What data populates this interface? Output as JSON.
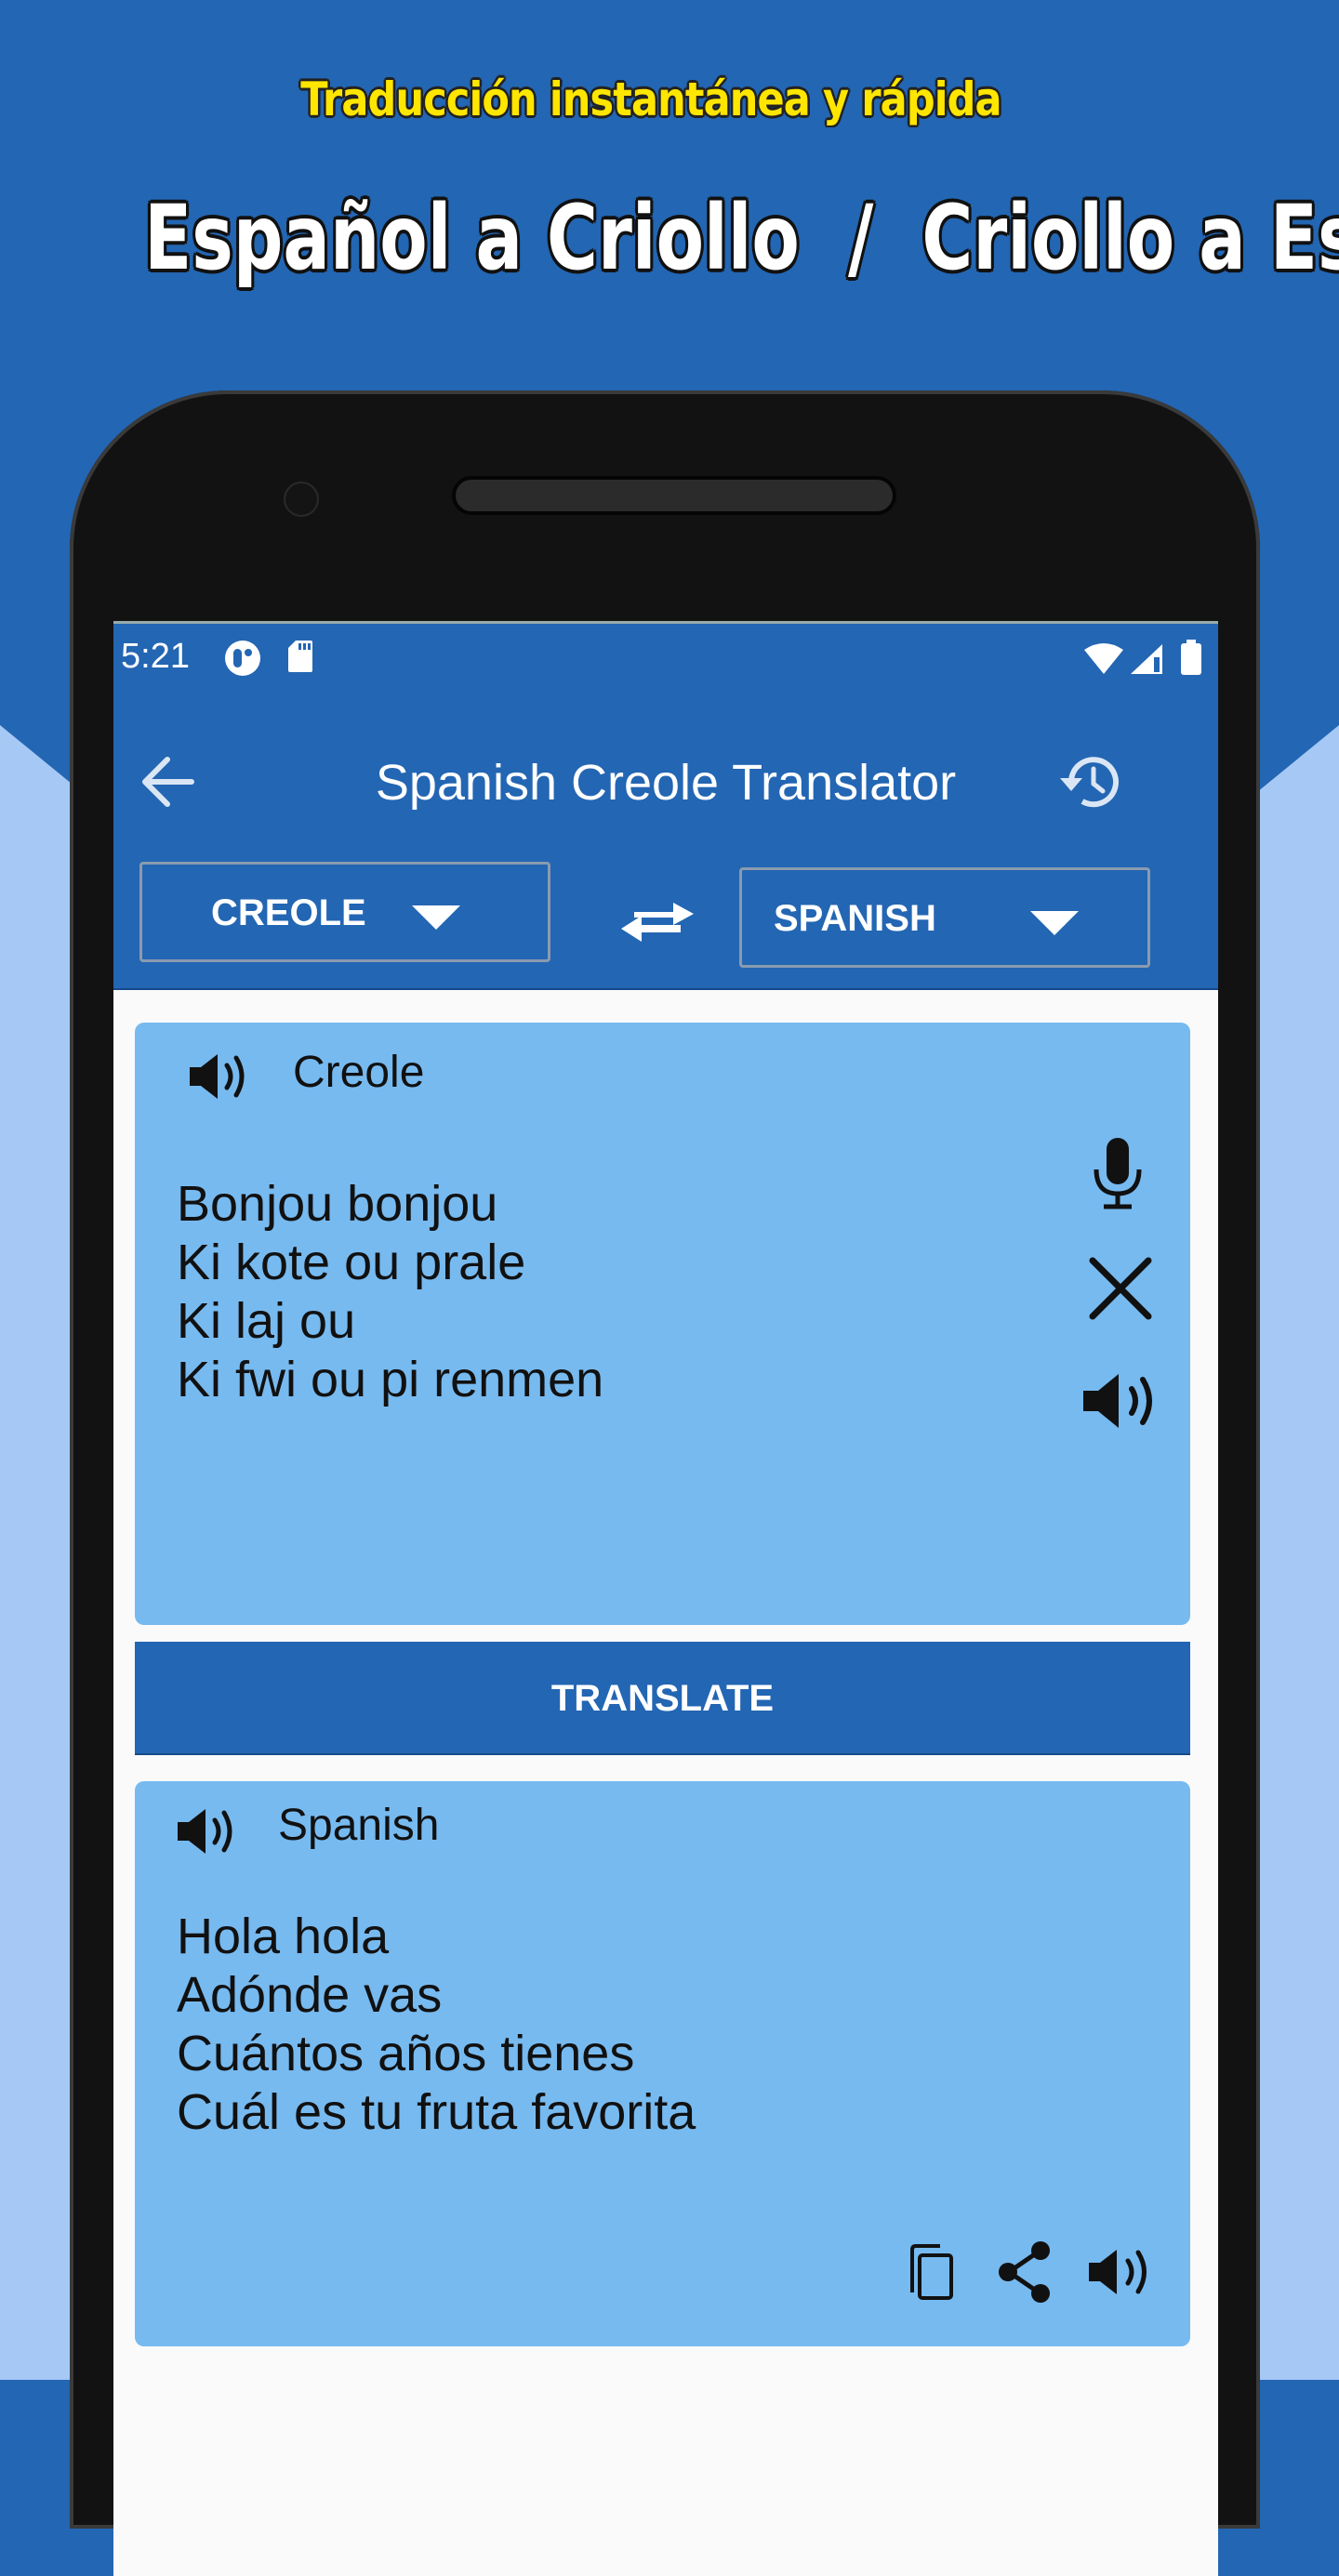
{
  "promo": {
    "subtitle": "Traducción instantánea y rápida",
    "title": "Español a Criollo  /  Criollo a Español"
  },
  "colors": {
    "primary_blue": "#2366b3",
    "light_blue_bg": "#a6c8f5",
    "card_blue": "#77baf0",
    "subtitle_yellow": "#ffe600"
  },
  "status_bar": {
    "time": "5:21",
    "left_icons": [
      "notification-app-icon",
      "sd-card-icon"
    ],
    "right_icons": [
      "wifi-icon",
      "cell-signal-icon",
      "battery-icon"
    ]
  },
  "app_bar": {
    "title": "Spanish Creole Translator",
    "back_icon": "arrow-back-icon",
    "history_icon": "history-icon"
  },
  "language_bar": {
    "source_language": "CREOLE",
    "target_language": "SPANISH",
    "swap_icon": "swap-arrows-icon"
  },
  "input_card": {
    "language_label": "Creole",
    "lines": [
      "Bonjou bonjou",
      "Ki kote ou prale",
      "Ki laj ou",
      "Ki fwi ou pi renmen"
    ],
    "actions": [
      "mic-icon",
      "clear-icon",
      "speaker-icon"
    ]
  },
  "translate_button": {
    "label": "TRANSLATE"
  },
  "output_card": {
    "language_label": "Spanish",
    "lines": [
      "Hola hola",
      "Adónde vas",
      "Cuántos años tienes",
      "Cuál es tu fruta favorita"
    ],
    "actions": [
      "copy-icon",
      "share-icon",
      "speaker-icon"
    ]
  }
}
